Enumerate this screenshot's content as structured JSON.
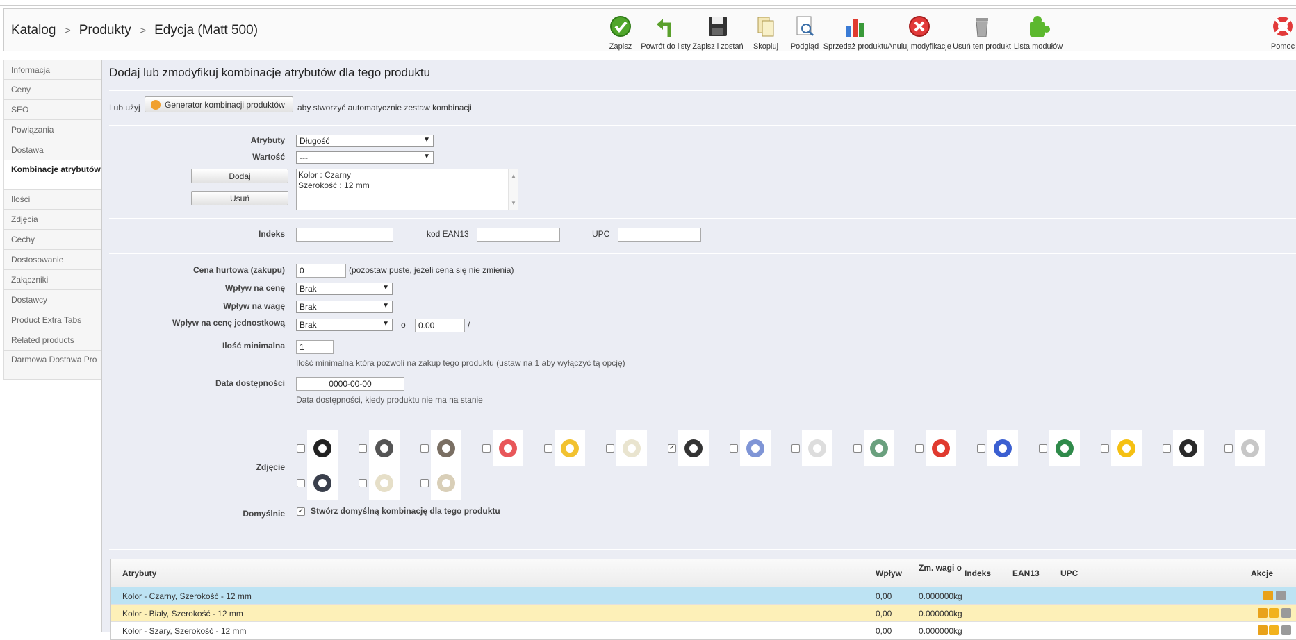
{
  "breadcrumb": [
    "Katalog",
    "Produkty",
    "Edycja (Matt 500)"
  ],
  "toolbar": [
    {
      "label": "Zapisz",
      "icon": "save-check-icon"
    },
    {
      "label": "Powrót do listy",
      "icon": "back-arrow-icon"
    },
    {
      "label": "Zapisz i zostań",
      "icon": "floppy-disk-icon"
    },
    {
      "label": "Skopiuj",
      "icon": "copy-icon"
    },
    {
      "label": "Podgląd",
      "icon": "preview-icon"
    },
    {
      "label": "Sprzedaż produktu",
      "icon": "bar-chart-icon"
    },
    {
      "label": "Anuluj modyfikacje",
      "icon": "cancel-icon"
    },
    {
      "label": "Usuń ten produkt",
      "icon": "trash-icon"
    },
    {
      "label": "Lista modułów",
      "icon": "puzzle-icon"
    },
    {
      "label": "Pomoc",
      "icon": "lifebuoy-icon"
    }
  ],
  "sidebar": [
    {
      "label": "Informacja"
    },
    {
      "label": "Ceny"
    },
    {
      "label": "SEO"
    },
    {
      "label": "Powiązania"
    },
    {
      "label": "Dostawa"
    },
    {
      "label": "Kombinacje atrybutów",
      "active": true
    },
    {
      "label": "Ilości"
    },
    {
      "label": "Zdjęcia"
    },
    {
      "label": "Cechy"
    },
    {
      "label": "Dostosowanie"
    },
    {
      "label": "Załączniki"
    },
    {
      "label": "Dostawcy"
    },
    {
      "label": "Product Extra Tabs"
    },
    {
      "label": "Related products"
    },
    {
      "label": "Darmowa Dostawa Pro"
    }
  ],
  "main": {
    "title": "Dodaj lub zmodyfikuj kombinacje atrybutów dla tego produktu",
    "generator_prefix": "Lub użyj",
    "generator_button": "Generator kombinacji produktów",
    "generator_suffix": "aby stworzyć automatycznie zestaw kombinacji",
    "attributes_label": "Atrybuty",
    "attributes_value": "Długość",
    "value_label": "Wartość",
    "value_value": "---",
    "add_button": "Dodaj",
    "remove_button": "Usuń",
    "selected_attributes": [
      "Kolor : Czarny",
      "Szerokość : 12 mm"
    ],
    "index_label": "Indeks",
    "index_value": "",
    "ean_label": "kod EAN13",
    "ean_value": "",
    "upc_label": "UPC",
    "upc_value": "",
    "wholesale_label": "Cena hurtowa (zakupu)",
    "wholesale_value": "0",
    "wholesale_note": "(pozostaw puste, jeżeli cena się nie zmienia)",
    "price_impact_label": "Wpływ na cenę",
    "price_impact_value": "Brak",
    "weight_impact_label": "Wpływ na wagę",
    "weight_impact_value": "Brak",
    "unit_impact_label": "Wpływ na cenę jednostkową",
    "unit_impact_value": "Brak",
    "unit_o": "o",
    "unit_amount": "0.00",
    "unit_slash": "/",
    "min_qty_label": "Ilość minimalna",
    "min_qty_value": "1",
    "min_qty_note": "Ilość minimalna która pozwoli na zakup tego produktu (ustaw na 1 aby wyłączyć tą opcję)",
    "avail_label": "Data dostępności",
    "avail_value": "0000-00-00",
    "avail_note": "Data dostępności, kiedy produktu nie ma na stanie",
    "images_label": "Zdjęcie",
    "default_label": "Domyślnie",
    "default_checkbox": "Stwórz domyślną kombinację dla tego produktu"
  },
  "images": [
    {
      "color": "#222222",
      "checked": false
    },
    {
      "color": "#555555",
      "checked": false
    },
    {
      "color": "#7a6f63",
      "checked": false
    },
    {
      "color": "#e8575a",
      "checked": false
    },
    {
      "color": "#f2c230",
      "checked": false
    },
    {
      "color": "#e9e4cf",
      "checked": false
    },
    {
      "color": "#333333",
      "checked": true
    },
    {
      "color": "#7f95d6",
      "checked": false
    },
    {
      "color": "#dddddd",
      "checked": false
    },
    {
      "color": "#6aa07e",
      "checked": false
    },
    {
      "color": "#e03a2f",
      "checked": false
    },
    {
      "color": "#3b5fd1",
      "checked": false
    },
    {
      "color": "#2f8a4a",
      "checked": false
    },
    {
      "color": "#f5c012",
      "checked": false
    },
    {
      "color": "#2a2a2a",
      "checked": false
    },
    {
      "color": "#c7c7c7",
      "checked": false
    },
    {
      "color": "#3a3f4c",
      "checked": false
    },
    {
      "color": "#e6dfc8",
      "checked": false
    },
    {
      "color": "#d9cfb8",
      "checked": false
    }
  ],
  "table": {
    "headers": {
      "attributes": "Atrybuty",
      "impact": "Wpływ",
      "weight": "Zm. wagi o",
      "index": "Indeks",
      "ean": "EAN13",
      "upc": "UPC",
      "actions": "Akcje"
    },
    "rows": [
      {
        "attributes": "Kolor - Czarny, Szerokość - 12 mm",
        "impact": "0,00",
        "weight": "0.000000kg",
        "bg": "#bde3f3"
      },
      {
        "attributes": "Kolor - Biały, Szerokość - 12 mm",
        "impact": "0,00",
        "weight": "0.000000kg",
        "bg": "#fdf0b8"
      },
      {
        "attributes": "Kolor - Szary, Szerokość - 12 mm",
        "impact": "0,00",
        "weight": "0.000000kg",
        "bg": "#ffffff"
      }
    ]
  }
}
